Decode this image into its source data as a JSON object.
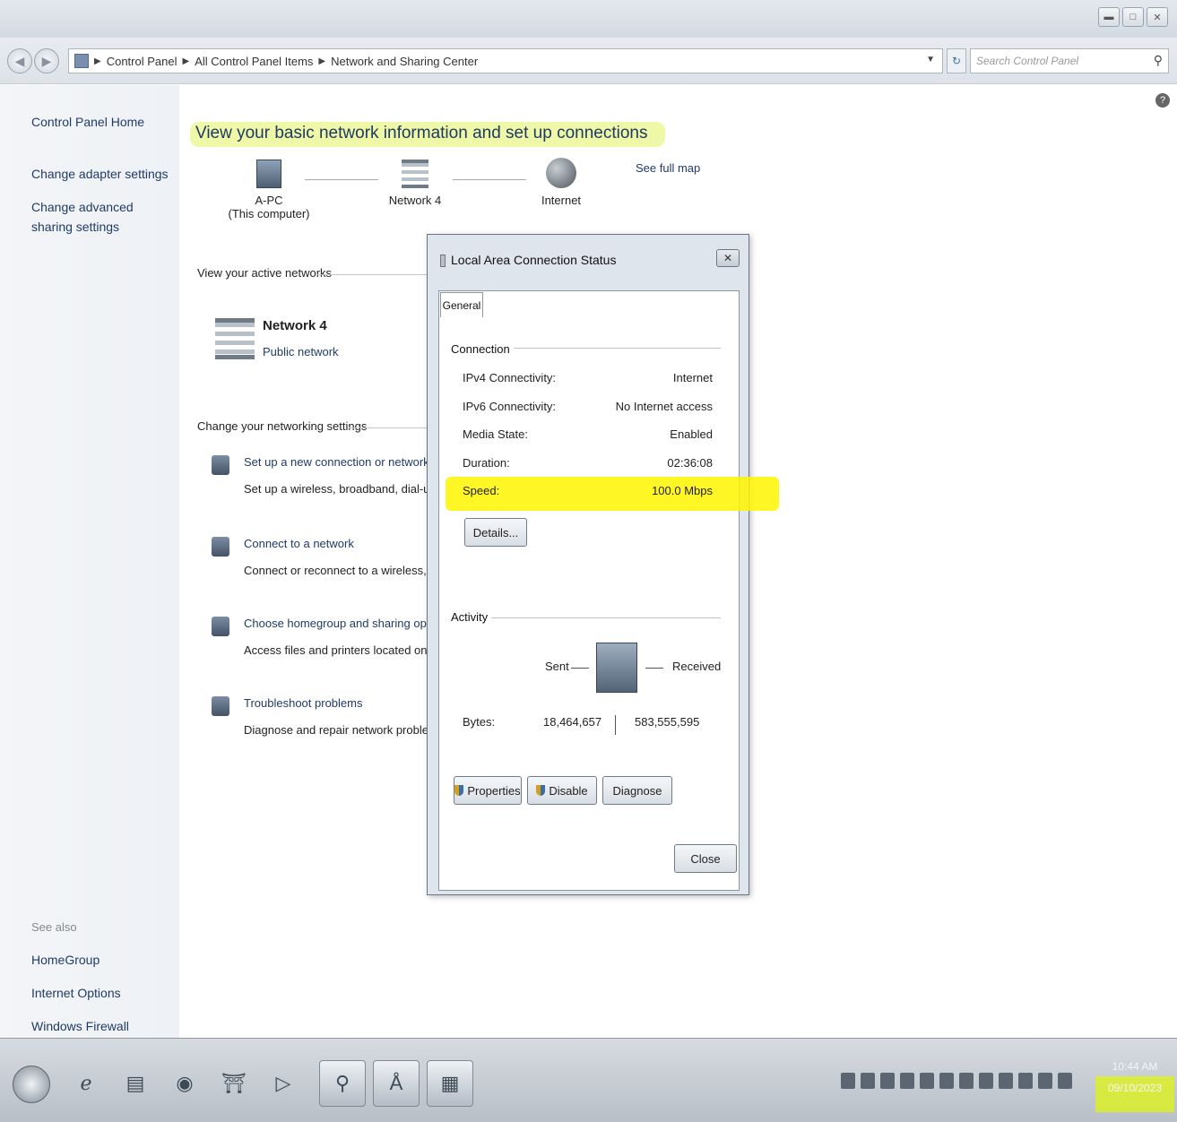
{
  "window": {
    "minimize_icon": "minimize-icon",
    "maximize_icon": "maximize-icon",
    "close_icon": "close-icon"
  },
  "address": {
    "breadcrumbs": [
      "Control Panel",
      "All Control Panel Items",
      "Network and Sharing Center"
    ],
    "search_placeholder": "Search Control Panel"
  },
  "sidebar": {
    "home": "Control Panel Home",
    "links": [
      "Change adapter settings",
      "Change advanced sharing settings"
    ],
    "see_also_label": "See also",
    "see_also": [
      "HomeGroup",
      "Internet Options",
      "Windows Firewall"
    ]
  },
  "main": {
    "heading": "View your basic network information and set up connections",
    "see_full_map": "See full map",
    "map": {
      "computer": "A-PC",
      "computer_sub": "(This computer)",
      "network": "Network 4",
      "internet": "Internet"
    },
    "active_networks_label": "View your active networks",
    "active_network": {
      "name": "Network 4",
      "type": "Public network"
    },
    "settings_label": "Change your networking settings",
    "tasks": [
      {
        "link": "Set up a new connection or network",
        "desc": "Set up a wireless, broadband, dial-up, ad"
      },
      {
        "link": "Connect to a network",
        "desc": "Connect or reconnect to a wireless, wired"
      },
      {
        "link": "Choose homegroup and sharing options",
        "desc": "Access files and printers located on other"
      },
      {
        "link": "Troubleshoot problems",
        "desc": "Diagnose and repair network problems, o"
      }
    ]
  },
  "dialog": {
    "title": "Local Area Connection Status",
    "tab": "General",
    "connection_label": "Connection",
    "rows": [
      {
        "label": "IPv4 Connectivity:",
        "value": "Internet"
      },
      {
        "label": "IPv6 Connectivity:",
        "value": "No Internet access"
      },
      {
        "label": "Media State:",
        "value": "Enabled"
      },
      {
        "label": "Duration:",
        "value": "02:36:08"
      },
      {
        "label": "Speed:",
        "value": "100.0 Mbps"
      }
    ],
    "details_button": "Details...",
    "activity_label": "Activity",
    "sent_label": "Sent",
    "received_label": "Received",
    "bytes_label": "Bytes:",
    "bytes_sent": "18,464,657",
    "bytes_received": "583,555,595",
    "properties_button": "Properties",
    "disable_button": "Disable",
    "diagnose_button": "Diagnose",
    "close_button": "Close"
  },
  "taskbar": {
    "time": "10:44 AM",
    "date": "09/10/2023"
  },
  "colors": {
    "highlight_yellow": "#fff500",
    "link_blue": "#1f3b66"
  }
}
